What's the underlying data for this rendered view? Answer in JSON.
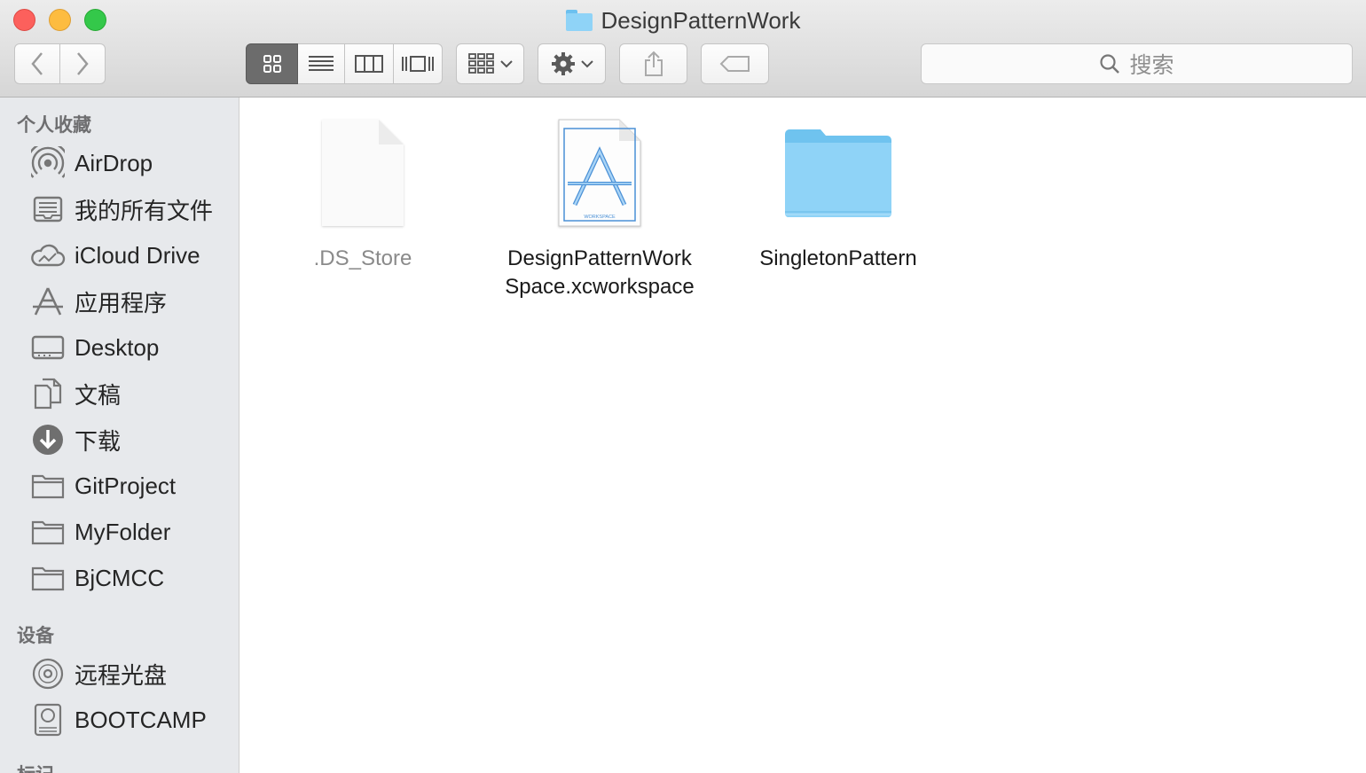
{
  "window": {
    "title": "DesignPatternWork"
  },
  "toolbar": {
    "back_icon": "chevron-left-icon",
    "forward_icon": "chevron-right-icon",
    "view_modes": [
      "icon-view",
      "list-view",
      "column-view",
      "cover-flow-view"
    ],
    "active_view": "icon-view",
    "search_placeholder": "搜索"
  },
  "sidebar": {
    "favorites_title": "个人收藏",
    "favorites": [
      {
        "label": "AirDrop",
        "icon": "airdrop-icon"
      },
      {
        "label": "我的所有文件",
        "icon": "all-files-icon"
      },
      {
        "label": "iCloud Drive",
        "icon": "cloud-icon"
      },
      {
        "label": "应用程序",
        "icon": "applications-icon"
      },
      {
        "label": "Desktop",
        "icon": "desktop-icon"
      },
      {
        "label": "文稿",
        "icon": "documents-icon"
      },
      {
        "label": "下载",
        "icon": "downloads-icon"
      },
      {
        "label": "GitProject",
        "icon": "folder-icon"
      },
      {
        "label": "MyFolder",
        "icon": "folder-icon"
      },
      {
        "label": "BjCMCC",
        "icon": "folder-icon"
      }
    ],
    "devices_title": "设备",
    "devices": [
      {
        "label": "远程光盘",
        "icon": "remote-disc-icon"
      },
      {
        "label": "BOOTCAMP",
        "icon": "hard-drive-icon"
      }
    ],
    "tags_title": "标记"
  },
  "files": [
    {
      "name": ".DS_Store",
      "kind": "document",
      "icon": "blank-document-icon"
    },
    {
      "name_line1": "DesignPatternWork",
      "name_line2": "Space.xcworkspace",
      "kind": "workspace",
      "icon": "xcworkspace-icon",
      "badge": "WORKSPACE"
    },
    {
      "name": "SingletonPattern",
      "kind": "folder",
      "icon": "folder-icon"
    }
  ],
  "colors": {
    "folder_blue": "#8fd3f7",
    "close": "#fc605c",
    "minimize": "#fdbc40",
    "maximize": "#34c84a"
  }
}
